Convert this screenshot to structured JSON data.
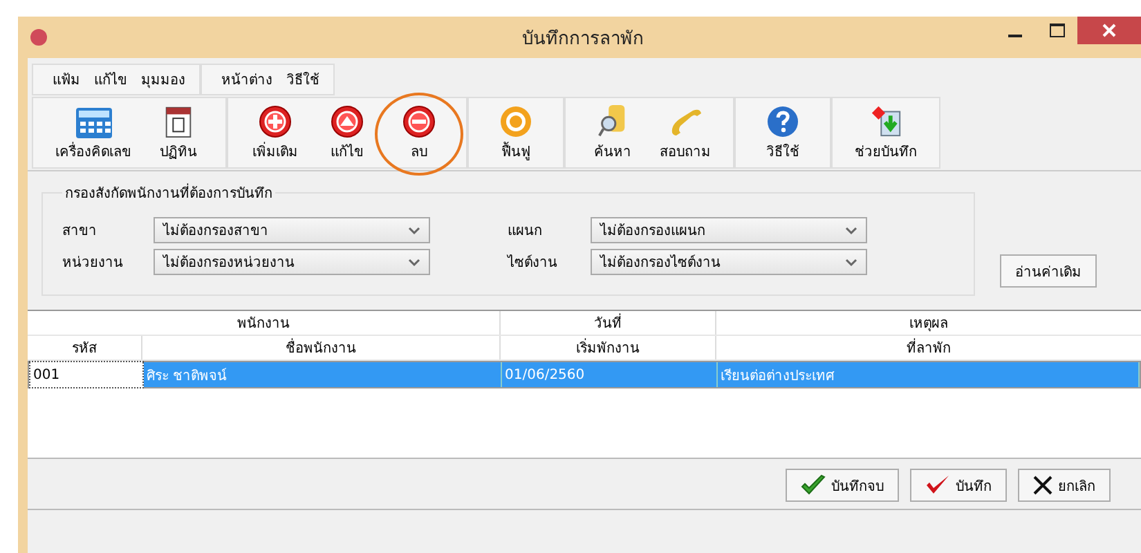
{
  "window": {
    "title": "บันทึกการลาพัก"
  },
  "menu_groups": [
    [
      "แฟ้ม",
      "แก้ไข",
      "มุมมอง"
    ],
    [
      "หน้าต่าง",
      "วิธีใช้"
    ]
  ],
  "toolbar_groups": [
    [
      {
        "label": "เครื่องคิดเลข",
        "kind": "calculator",
        "highlighted": false
      },
      {
        "label": "ปฏิทิน",
        "kind": "calendar",
        "highlighted": false
      }
    ],
    [
      {
        "label": "เพิ่มเติม",
        "kind": "add",
        "highlighted": false
      },
      {
        "label": "แก้ไข",
        "kind": "edit",
        "highlighted": false
      },
      {
        "label": "ลบ",
        "kind": "delete",
        "highlighted": true
      }
    ],
    [
      {
        "label": "ฟื้นฟู",
        "kind": "restore",
        "highlighted": false
      }
    ],
    [
      {
        "label": "ค้นหา",
        "kind": "search",
        "highlighted": false
      },
      {
        "label": "สอบถาม",
        "kind": "phone",
        "highlighted": false
      }
    ],
    [
      {
        "label": "วิธีใช้",
        "kind": "help",
        "highlighted": false
      }
    ],
    [
      {
        "label": "ช่วยบันทึก",
        "kind": "assist",
        "highlighted": false
      }
    ]
  ],
  "filter": {
    "title": "กรองสังกัดพนักงานที่ต้องการบันทึก",
    "fields": [
      {
        "label": "สาขา",
        "value": "ไม่ต้องกรองสาขา"
      },
      {
        "label": "แผนก",
        "value": "ไม่ต้องกรองแผนก"
      },
      {
        "label": "หน่วยงาน",
        "value": "ไม่ต้องกรองหน่วยงาน"
      },
      {
        "label": "ไซต์งาน",
        "value": "ไม่ต้องกรองไซต์งาน"
      }
    ],
    "button": "อ่านค่าเดิม"
  },
  "table": {
    "column_groups": [
      "พนักงาน",
      "วันที่",
      "เหตุผล"
    ],
    "columns": [
      "รหัส",
      "ชื่อพนักงาน",
      "เริ่มพักงาน",
      "ที่ลาพัก"
    ],
    "rows": [
      {
        "cells": [
          "001",
          "ศิระ  ชาติพจน์",
          "01/06/2560",
          "เรียนต่อต่างประเทศ"
        ],
        "selected": true
      }
    ]
  },
  "buttons": [
    {
      "label": "บันทึกจบ",
      "kind": "save-close"
    },
    {
      "label": "บันทึก",
      "kind": "save"
    },
    {
      "label": "ยกเลิก",
      "kind": "cancel"
    }
  ]
}
